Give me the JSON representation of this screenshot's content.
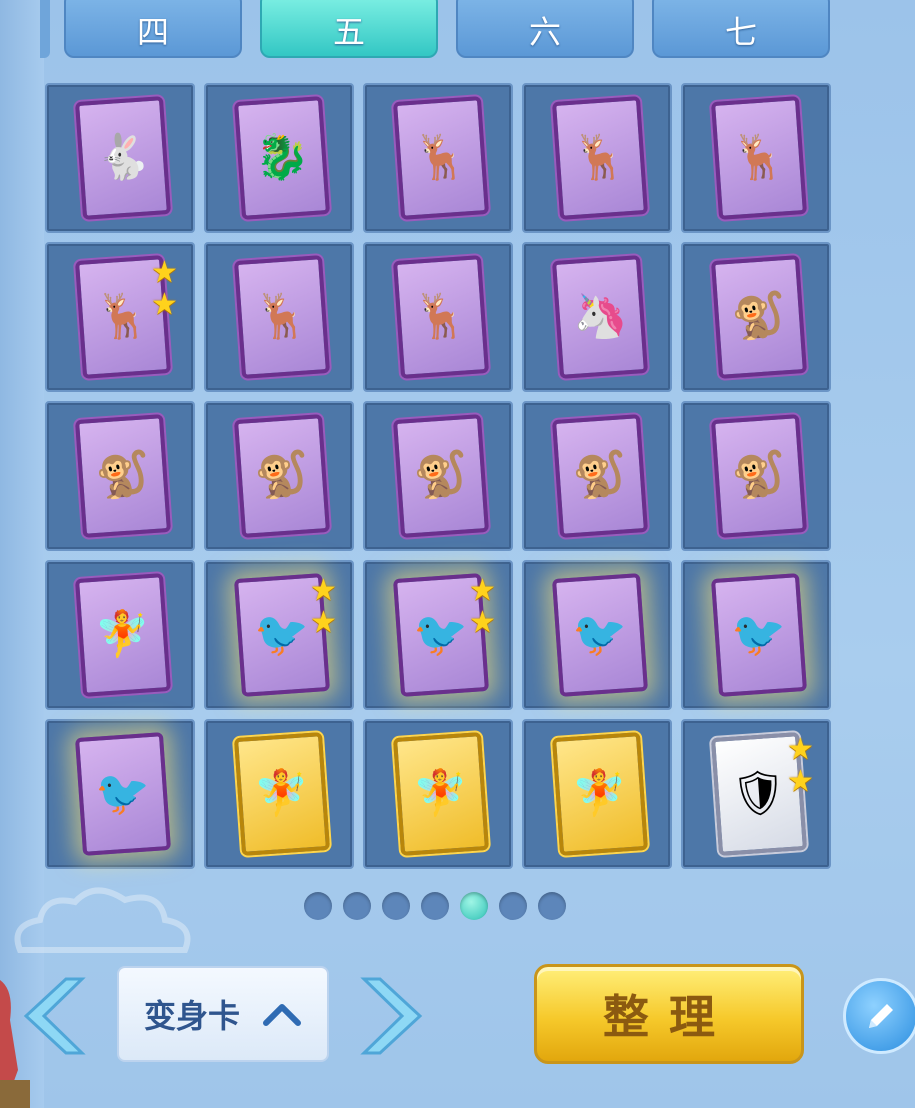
{
  "tabs": [
    {
      "label": "四",
      "active": false
    },
    {
      "label": "五",
      "active": true
    },
    {
      "label": "六",
      "active": false
    },
    {
      "label": "七",
      "active": false
    }
  ],
  "slots": [
    {
      "icon": "white-rabbit-card-icon",
      "glyph": "🐇",
      "frame": "purple",
      "stars": 0,
      "glow": false
    },
    {
      "icon": "green-dragon-card-icon",
      "glyph": "🐉",
      "frame": "purple",
      "stars": 0,
      "glow": false
    },
    {
      "icon": "white-deer-card-icon",
      "glyph": "🦌",
      "frame": "purple",
      "stars": 0,
      "glow": false
    },
    {
      "icon": "white-deer-card-icon",
      "glyph": "🦌",
      "frame": "purple",
      "stars": 0,
      "glow": false
    },
    {
      "icon": "white-deer-card-icon",
      "glyph": "🦌",
      "frame": "purple",
      "stars": 0,
      "glow": false
    },
    {
      "icon": "white-deer-card-icon",
      "glyph": "🦌",
      "frame": "purple",
      "stars": 2,
      "glow": false
    },
    {
      "icon": "white-deer-card-icon",
      "glyph": "🦌",
      "frame": "purple",
      "stars": 0,
      "glow": false
    },
    {
      "icon": "white-deer-card-icon",
      "glyph": "🦌",
      "frame": "purple",
      "stars": 0,
      "glow": false
    },
    {
      "icon": "ice-beast-card-icon",
      "glyph": "🦄",
      "frame": "purple",
      "stars": 0,
      "glow": false
    },
    {
      "icon": "monkey-card-icon",
      "glyph": "🐒",
      "frame": "purple",
      "stars": 0,
      "glow": false
    },
    {
      "icon": "monkey-card-icon",
      "glyph": "🐒",
      "frame": "purple",
      "stars": 0,
      "glow": false
    },
    {
      "icon": "monkey-card-icon",
      "glyph": "🐒",
      "frame": "purple",
      "stars": 0,
      "glow": false
    },
    {
      "icon": "monkey-card-icon",
      "glyph": "🐒",
      "frame": "purple",
      "stars": 0,
      "glow": false
    },
    {
      "icon": "monkey-card-icon",
      "glyph": "🐒",
      "frame": "purple",
      "stars": 0,
      "glow": false
    },
    {
      "icon": "monkey-card-icon",
      "glyph": "🐒",
      "frame": "purple",
      "stars": 0,
      "glow": false
    },
    {
      "icon": "twin-fairies-card-icon",
      "glyph": "🧚",
      "frame": "purple",
      "stars": 0,
      "glow": false
    },
    {
      "icon": "phoenix-bird-card-icon",
      "glyph": "🐦",
      "frame": "purple",
      "stars": 2,
      "glow": true
    },
    {
      "icon": "phoenix-bird-card-icon",
      "glyph": "🐦",
      "frame": "purple",
      "stars": 2,
      "glow": true
    },
    {
      "icon": "phoenix-bird-card-icon",
      "glyph": "🐦",
      "frame": "purple",
      "stars": 0,
      "glow": true
    },
    {
      "icon": "phoenix-bird-card-icon",
      "glyph": "🐦",
      "frame": "purple",
      "stars": 0,
      "glow": true
    },
    {
      "icon": "phoenix-bird-card-icon",
      "glyph": "🐦",
      "frame": "purple",
      "stars": 0,
      "glow": true
    },
    {
      "icon": "fairy-girl-card-icon",
      "glyph": "🧚",
      "frame": "gold",
      "stars": 0,
      "glow": false
    },
    {
      "icon": "fairy-girl-card-icon",
      "glyph": "🧚",
      "frame": "gold",
      "stars": 0,
      "glow": false
    },
    {
      "icon": "fairy-girl-card-icon",
      "glyph": "🧚",
      "frame": "gold",
      "stars": 0,
      "glow": false
    },
    {
      "icon": "armored-warrior-card-icon",
      "glyph": "🛡",
      "frame": "silver",
      "stars": 2,
      "glow": false
    }
  ],
  "pagination": {
    "total": 7,
    "current_index": 4
  },
  "type_selector": {
    "label": "变身卡",
    "icon": "chevron-up-icon"
  },
  "nav": {
    "prev_icon": "arrow-left-icon",
    "next_icon": "arrow-right-icon"
  },
  "sort_button": {
    "label": "整理"
  },
  "edit_button": {
    "icon": "pencil-icon"
  },
  "colors": {
    "active_tab": "#33c7c4",
    "slot_bg": "#4d77a8",
    "sort_button": "#f6c92b",
    "star": "#ffd21c"
  }
}
